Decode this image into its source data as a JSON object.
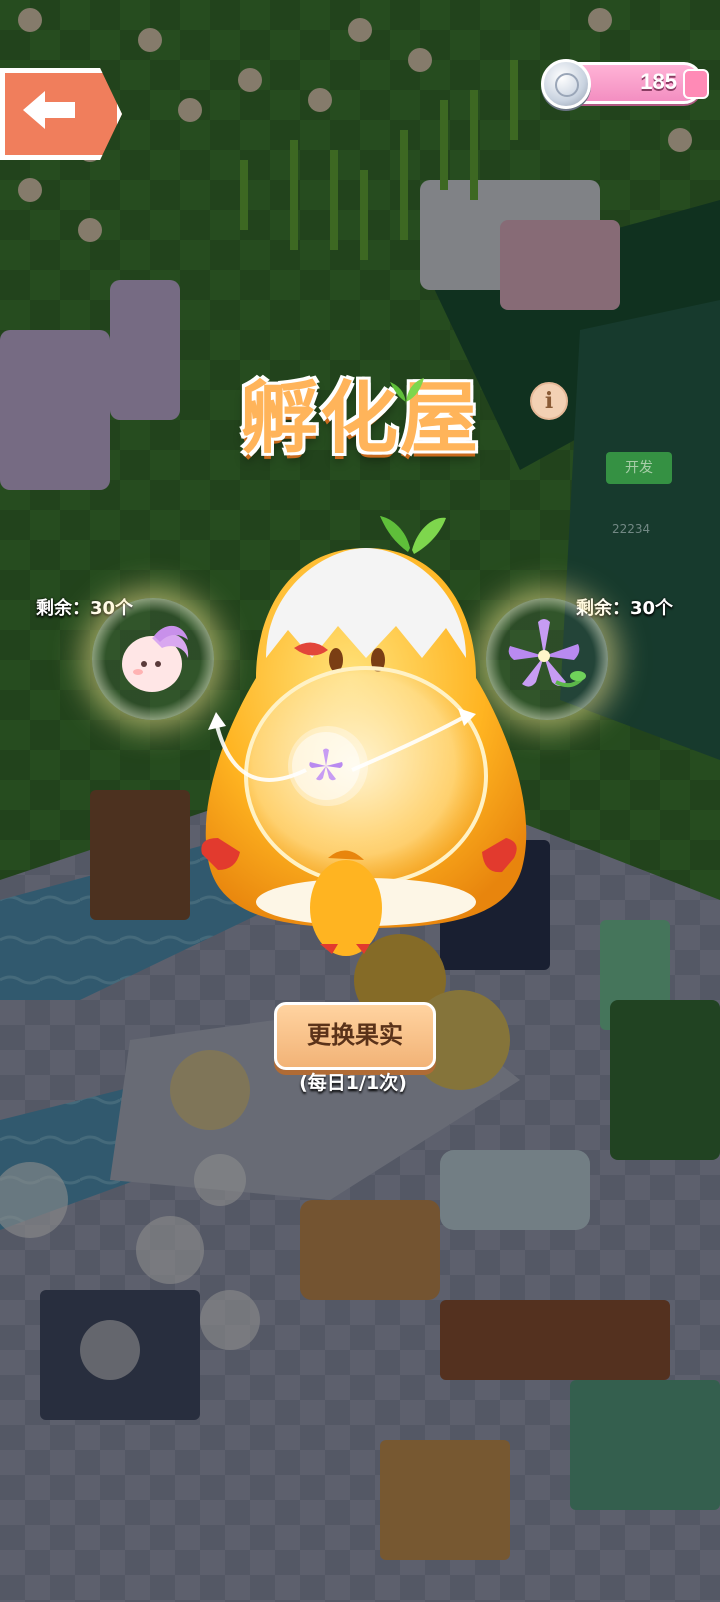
{
  "hud": {
    "currency_value": "185"
  },
  "hatchery": {
    "title": "孵化屋",
    "info_label": "i",
    "left_remaining": "剩余：30个",
    "right_remaining": "剩余：30个",
    "swap_button_label": "更换果实",
    "daily_limit": "(每日1/1次)"
  },
  "background": {
    "dev_badge": "开发",
    "counter": "22234"
  },
  "colors": {
    "accent_orange": "#f2b377",
    "currency_pink": "#f38ec1",
    "back_button": "#f07e5c",
    "title_orange": "#ffb45a"
  }
}
